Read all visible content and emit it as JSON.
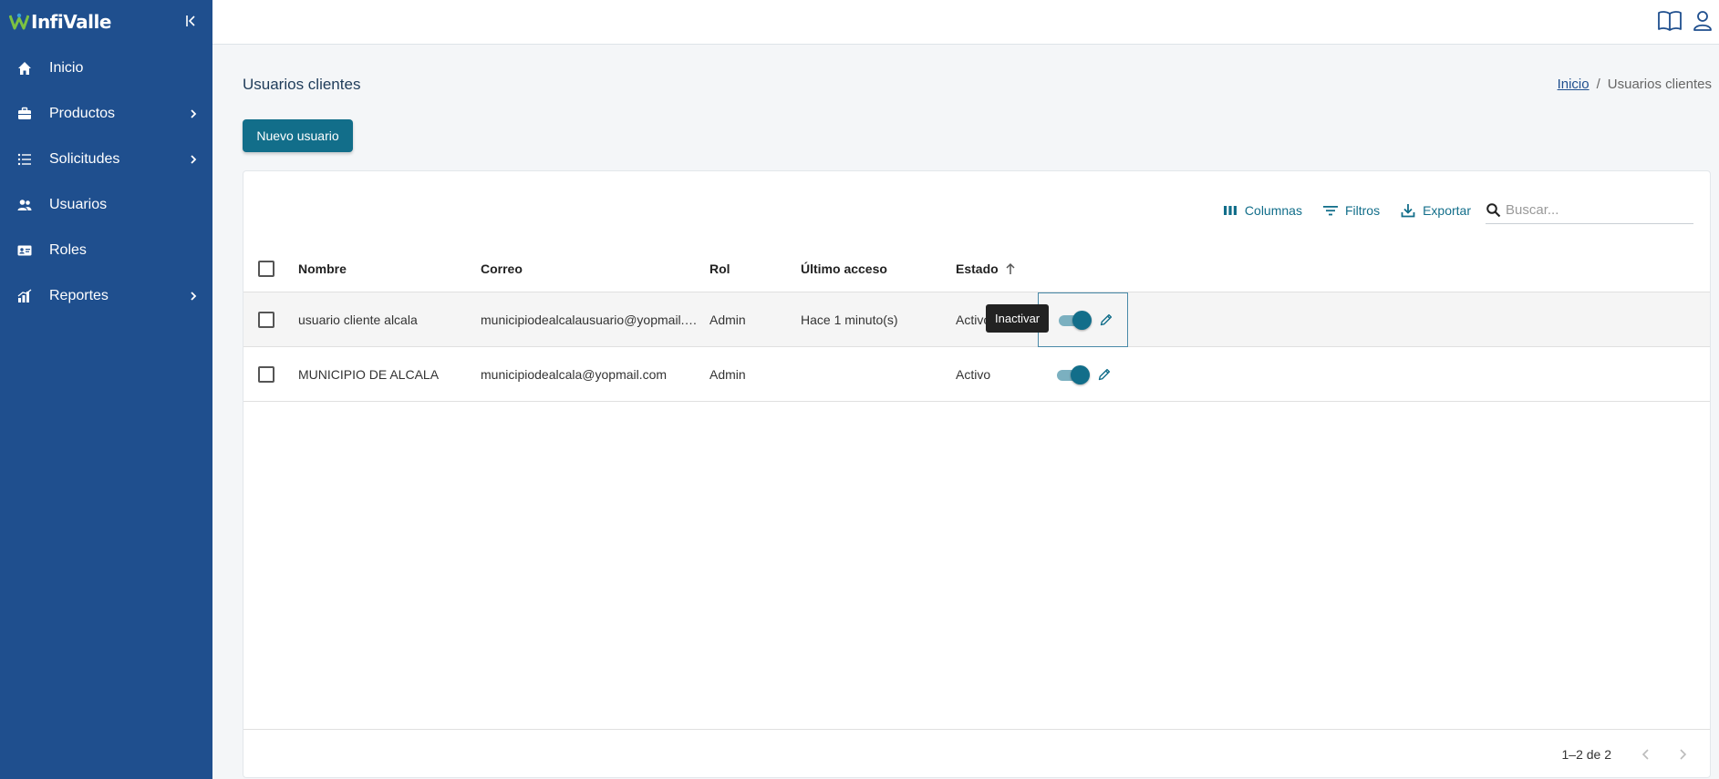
{
  "app": {
    "logo_text": "InfiValle"
  },
  "sidebar": {
    "items": [
      {
        "label": "Inicio",
        "icon": "home-icon",
        "has_submenu": false
      },
      {
        "label": "Productos",
        "icon": "briefcase-icon",
        "has_submenu": true
      },
      {
        "label": "Solicitudes",
        "icon": "list-icon",
        "has_submenu": true
      },
      {
        "label": "Usuarios",
        "icon": "users-icon",
        "has_submenu": false
      },
      {
        "label": "Roles",
        "icon": "id-card-icon",
        "has_submenu": false
      },
      {
        "label": "Reportes",
        "icon": "bar-chart-icon",
        "has_submenu": true
      }
    ]
  },
  "header": {
    "icons": [
      "book-icon",
      "user-icon"
    ]
  },
  "page": {
    "title": "Usuarios clientes",
    "breadcrumb": {
      "home": "Inicio",
      "separator": "/",
      "current": "Usuarios clientes"
    },
    "new_button": "Nuevo usuario"
  },
  "toolbar": {
    "columns": "Columnas",
    "filters": "Filtros",
    "export": "Exportar",
    "search_placeholder": "Buscar..."
  },
  "table": {
    "headers": {
      "nombre": "Nombre",
      "correo": "Correo",
      "rol": "Rol",
      "acceso": "Último acceso",
      "estado": "Estado"
    },
    "rows": [
      {
        "nombre": "usuario cliente alcala",
        "correo": "municipiodealcalausuario@yopmail.…",
        "rol": "Admin",
        "acceso": "Hace 1 minuto(s)",
        "estado": "Activo",
        "active": true
      },
      {
        "nombre": "MUNICIPIO DE ALCALA",
        "correo": "municipiodealcala@yopmail.com",
        "rol": "Admin",
        "acceso": "",
        "estado": "Activo",
        "active": true
      }
    ],
    "tooltip": "Inactivar"
  },
  "pagination": {
    "label": "1–2 de 2"
  },
  "colors": {
    "sidebar": "#1f4f8e",
    "accent": "#126e8a",
    "switch_track": "#7bb0c0"
  }
}
